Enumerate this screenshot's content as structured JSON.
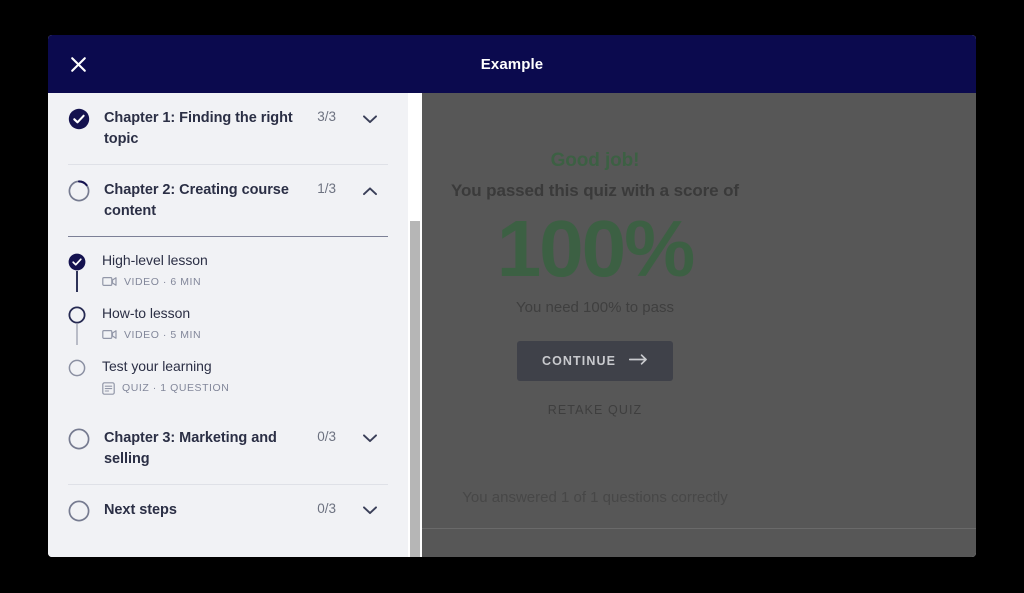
{
  "modal": {
    "title": "Example",
    "close_icon": "close-icon"
  },
  "outline": {
    "chapters": [
      {
        "title": "Chapter 1: Finding the right topic",
        "count": "3/3",
        "state": "complete",
        "chevron": "chevron-down-icon",
        "expanded": false
      },
      {
        "title": "Chapter 2: Creating course content",
        "count": "1/3",
        "state": "partial",
        "chevron": "chevron-up-icon",
        "expanded": true,
        "lessons": [
          {
            "title": "High-level lesson",
            "meta": "VIDEO · 6 MIN",
            "type_icon": "video-icon",
            "state": "complete"
          },
          {
            "title": "How-to lesson",
            "meta": "VIDEO · 5 MIN",
            "type_icon": "video-icon",
            "state": "current"
          },
          {
            "title": "Test your learning",
            "meta": "QUIZ · 1 QUESTION",
            "type_icon": "quiz-icon",
            "state": "incomplete"
          }
        ]
      },
      {
        "title": "Chapter 3: Marketing and selling",
        "count": "0/3",
        "state": "incomplete",
        "chevron": "chevron-down-icon",
        "expanded": false
      },
      {
        "title": "Next steps",
        "count": "0/3",
        "state": "incomplete",
        "chevron": "chevron-down-icon",
        "expanded": false
      }
    ]
  },
  "quiz_result": {
    "headline": "Good job!",
    "subtitle": "You passed this quiz with a score of",
    "score": "100%",
    "requirement": "You need 100% to pass",
    "continue_label": "CONTINUE",
    "continue_icon": "arrow-right-icon",
    "retake_label": "RETAKE QUIZ",
    "answered_note": "You answered 1 of 1 questions correctly"
  },
  "colors": {
    "brand_navy": "#0b0a4e",
    "sidebar_bg": "#f1f2f5",
    "text_dark": "#2b2f45",
    "muted": "#6d7280",
    "success_green": "#3c6043",
    "overlay": "#575757"
  },
  "scrollbar": {
    "name": "outline-scrollbar"
  }
}
